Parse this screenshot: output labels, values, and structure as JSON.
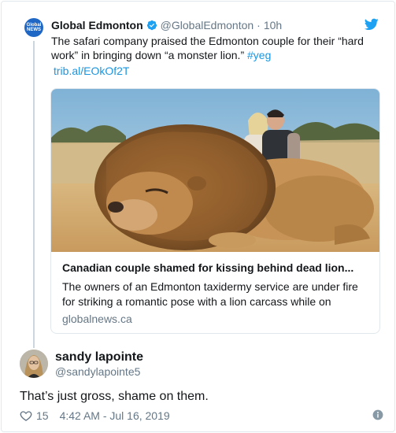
{
  "quoted_tweet": {
    "avatar_text": "Global NEWS",
    "author_name": "Global Edmonton",
    "handle": "@GlobalEdmonton",
    "separator": "·",
    "time": "10h",
    "text_part1": "The safari company praised the Edmonton couple for their “hard work” in bringing down “a monster lion.” ",
    "hashtag": "#yeg",
    "link": "trib.al/EOkOf2T",
    "link_card": {
      "title": "Canadian couple shamed for kissing behind dead lion...",
      "description": "The owners of an Edmonton taxidermy service are under fire for striking a romantic pose with a lion carcass while on",
      "domain": "globalnews.ca"
    }
  },
  "reply": {
    "author_name": "sandy lapointe",
    "handle": "@sandylapointe5",
    "text": "That’s just gross, shame on them.",
    "like_count": "15",
    "timestamp": "4:42 AM - Jul 16, 2019"
  },
  "colors": {
    "link_blue": "#1b95e0",
    "secondary_text": "#657786",
    "verified_blue": "#1da1f2",
    "global_blue": "#1f67c4"
  },
  "icons": [
    "verified-badge-icon",
    "twitter-bird-icon",
    "heart-icon",
    "info-icon"
  ]
}
